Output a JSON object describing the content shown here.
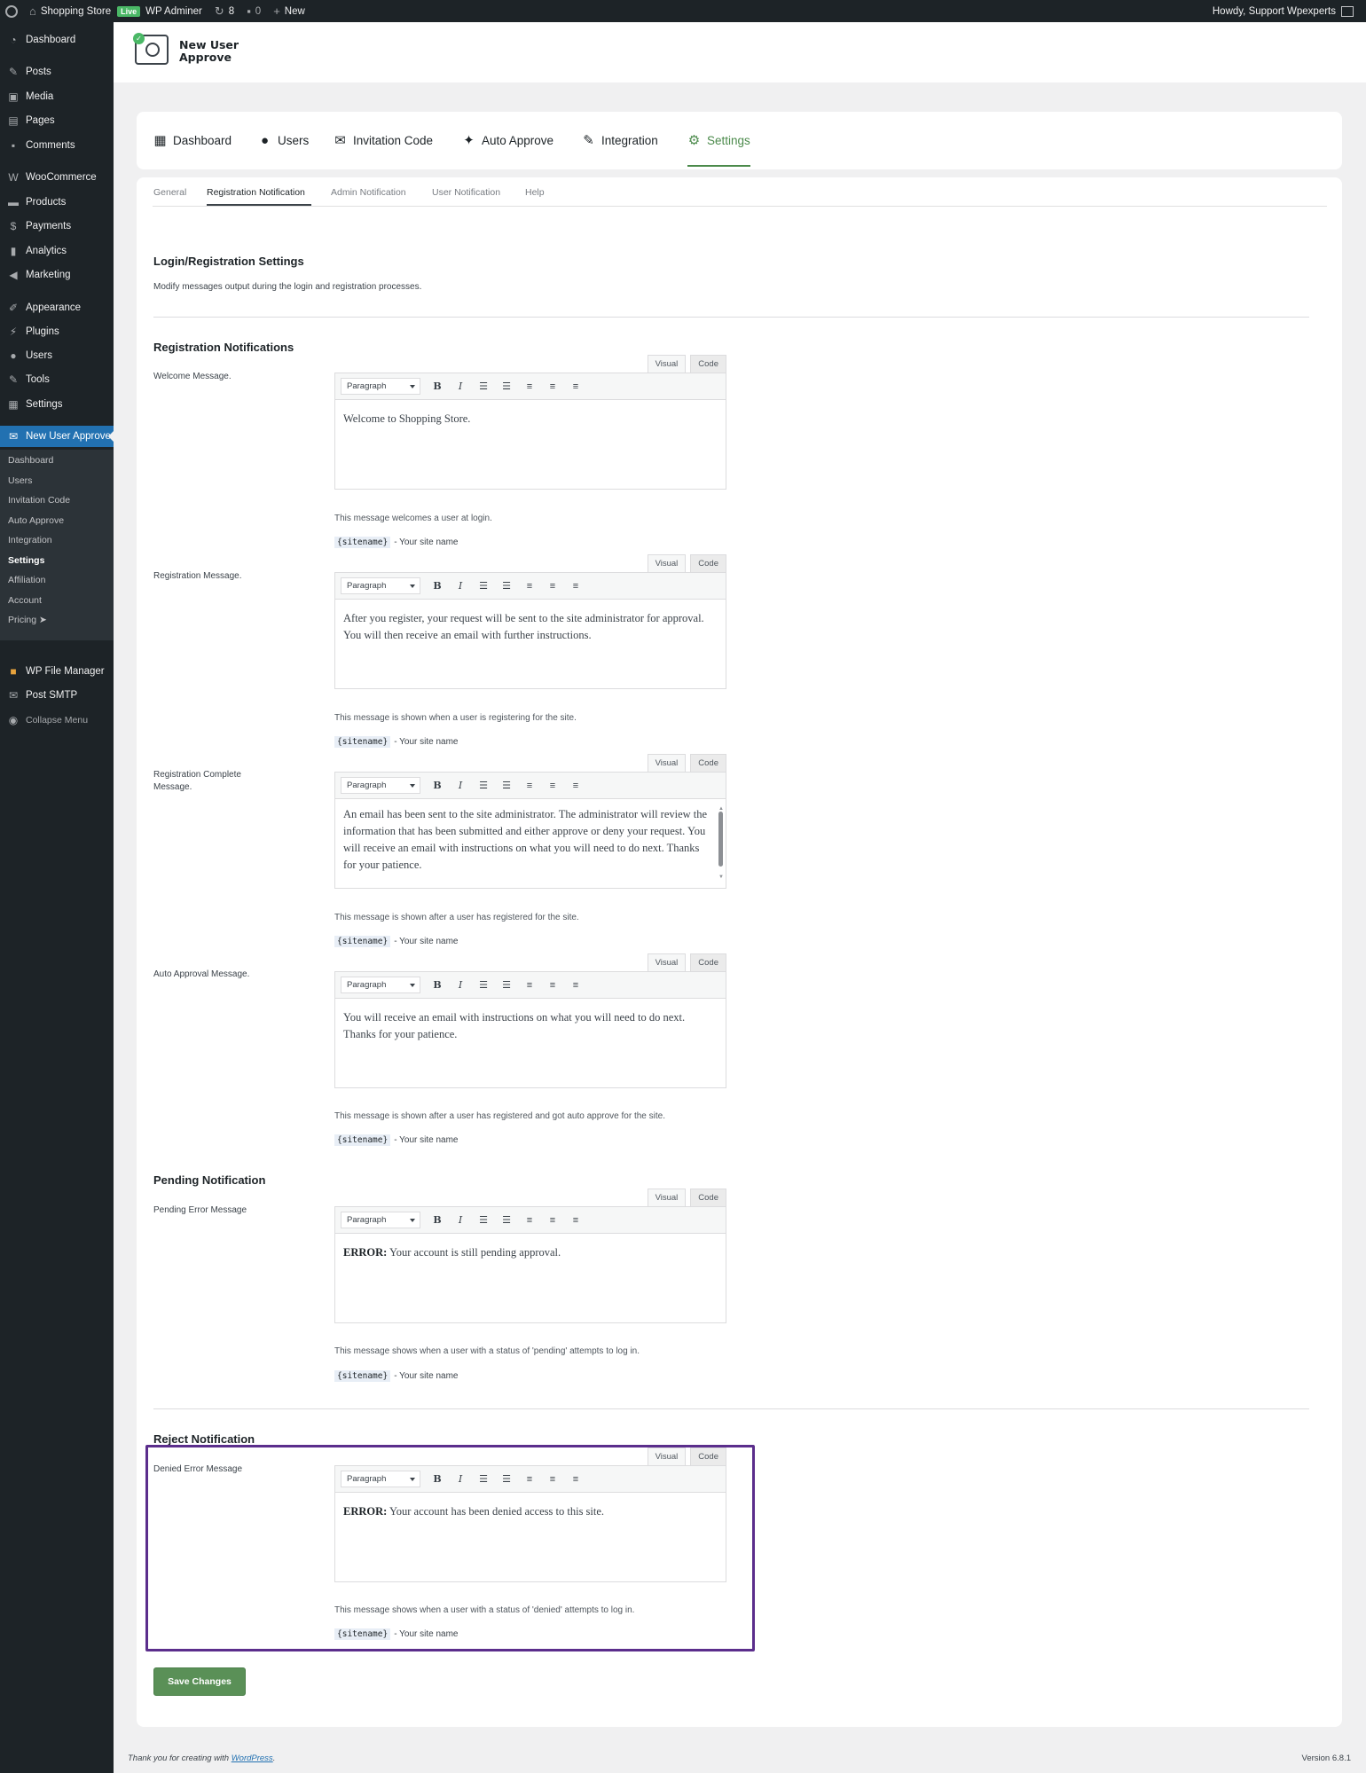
{
  "admin_bar": {
    "site_name": "Shopping Store",
    "live_badge": "Live",
    "wp_admin_label": "WP Adminer",
    "updates_count": "8",
    "comments_count": "0",
    "new_label": "New",
    "howdy": "Howdy, Support Wpexperts"
  },
  "sidebar": {
    "items": [
      {
        "label": "Dashboard",
        "icon": "dashboard-icon"
      },
      {
        "label": "Posts",
        "icon": "pin-icon"
      },
      {
        "label": "Media",
        "icon": "media-icon"
      },
      {
        "label": "Pages",
        "icon": "pages-icon"
      },
      {
        "label": "Comments",
        "icon": "comments-icon"
      },
      {
        "label": "WooCommerce",
        "icon": "woocommerce-icon"
      },
      {
        "label": "Products",
        "icon": "products-icon"
      },
      {
        "label": "Payments",
        "icon": "payments-icon"
      },
      {
        "label": "Analytics",
        "icon": "analytics-icon"
      },
      {
        "label": "Marketing",
        "icon": "marketing-icon"
      },
      {
        "label": "Appearance",
        "icon": "appearance-icon"
      },
      {
        "label": "Plugins",
        "icon": "plugins-icon"
      },
      {
        "label": "Users",
        "icon": "users-icon"
      },
      {
        "label": "Tools",
        "icon": "tools-icon"
      },
      {
        "label": "Settings",
        "icon": "settings-icon"
      },
      {
        "label": "New User Approve",
        "icon": "new-user-approve-icon"
      },
      {
        "label": "WP File Manager",
        "icon": "file-manager-icon"
      },
      {
        "label": "Post SMTP",
        "icon": "mail-icon"
      },
      {
        "label": "Collapse Menu",
        "icon": "collapse-icon"
      }
    ],
    "submenu": [
      "Dashboard",
      "Users",
      "Invitation Code",
      "Auto Approve",
      "Integration",
      "Settings",
      "Affiliation",
      "Account",
      "Pricing ➤"
    ]
  },
  "plugin": {
    "logo_line1": "New User",
    "logo_line2": "Approve"
  },
  "nav_tabs": [
    {
      "label": "Dashboard",
      "icon": "dashboard-icon"
    },
    {
      "label": "Users",
      "icon": "user-icon"
    },
    {
      "label": "Invitation Code",
      "icon": "envelope-icon"
    },
    {
      "label": "Auto Approve",
      "icon": "magic-wand-icon"
    },
    {
      "label": "Integration",
      "icon": "wrench-icon"
    },
    {
      "label": "Settings",
      "icon": "gear-icon"
    }
  ],
  "sub_tabs": [
    "General",
    "Registration Notification",
    "Admin Notification",
    "User Notification",
    "Help"
  ],
  "section_login": {
    "title": "Login/Registration Settings",
    "description": "Modify messages output during the login and registration processes."
  },
  "section_registration": {
    "title": "Registration Notifications"
  },
  "section_pending": {
    "title": "Pending Notification"
  },
  "section_reject": {
    "title": "Reject Notification"
  },
  "editor_ui": {
    "visual_tab": "Visual",
    "code_tab": "Code",
    "format_select": "Paragraph",
    "tag": "{sitename}",
    "tag_desc": "- Your site name"
  },
  "fields": {
    "welcome": {
      "label": "Welcome Message.",
      "content": "Welcome to Shopping Store.",
      "help": "This message welcomes a user at login."
    },
    "registration": {
      "label": "Registration Message.",
      "content": "After you register, your request will be sent to the site administrator for approval. You will then receive an email with further instructions.",
      "help": "This message is shown when a user is registering for the site."
    },
    "registration_complete": {
      "label": "Registration Complete Message.",
      "content": "An email has been sent to the site administrator. The administrator will review the information that has been submitted and either approve or deny your request. You will receive an email with instructions on what you will need to do next. Thanks for your patience.",
      "help": "This message is shown after a user has registered for the site."
    },
    "auto_approval": {
      "label": "Auto Approval Message.",
      "content": "You will receive an email with instructions on what you will need to do next. Thanks for your patience.",
      "help": "This message is shown after a user has registered and got auto approve for the site."
    },
    "pending": {
      "label": "Pending Error Message",
      "content_bold": "ERROR:",
      "content": " Your account is still pending approval.",
      "help": "This message shows when a user with a status of 'pending' attempts to log in."
    },
    "denied": {
      "label": "Denied Error Message",
      "content_bold": "ERROR:",
      "content": " Your account has been denied access to this site.",
      "help": "This message shows when a user with a status of 'denied' attempts to log in."
    }
  },
  "save_button": "Save Changes",
  "footer": {
    "thanks_prefix": "Thank you for creating with ",
    "wordpress_link": "WordPress",
    "thanks_suffix": ".",
    "version": "Version 6.8.1"
  },
  "colors": {
    "accent_green": "#4b8a4b",
    "wp_blue": "#2271b1",
    "highlight_purple": "#5b2e8c"
  }
}
